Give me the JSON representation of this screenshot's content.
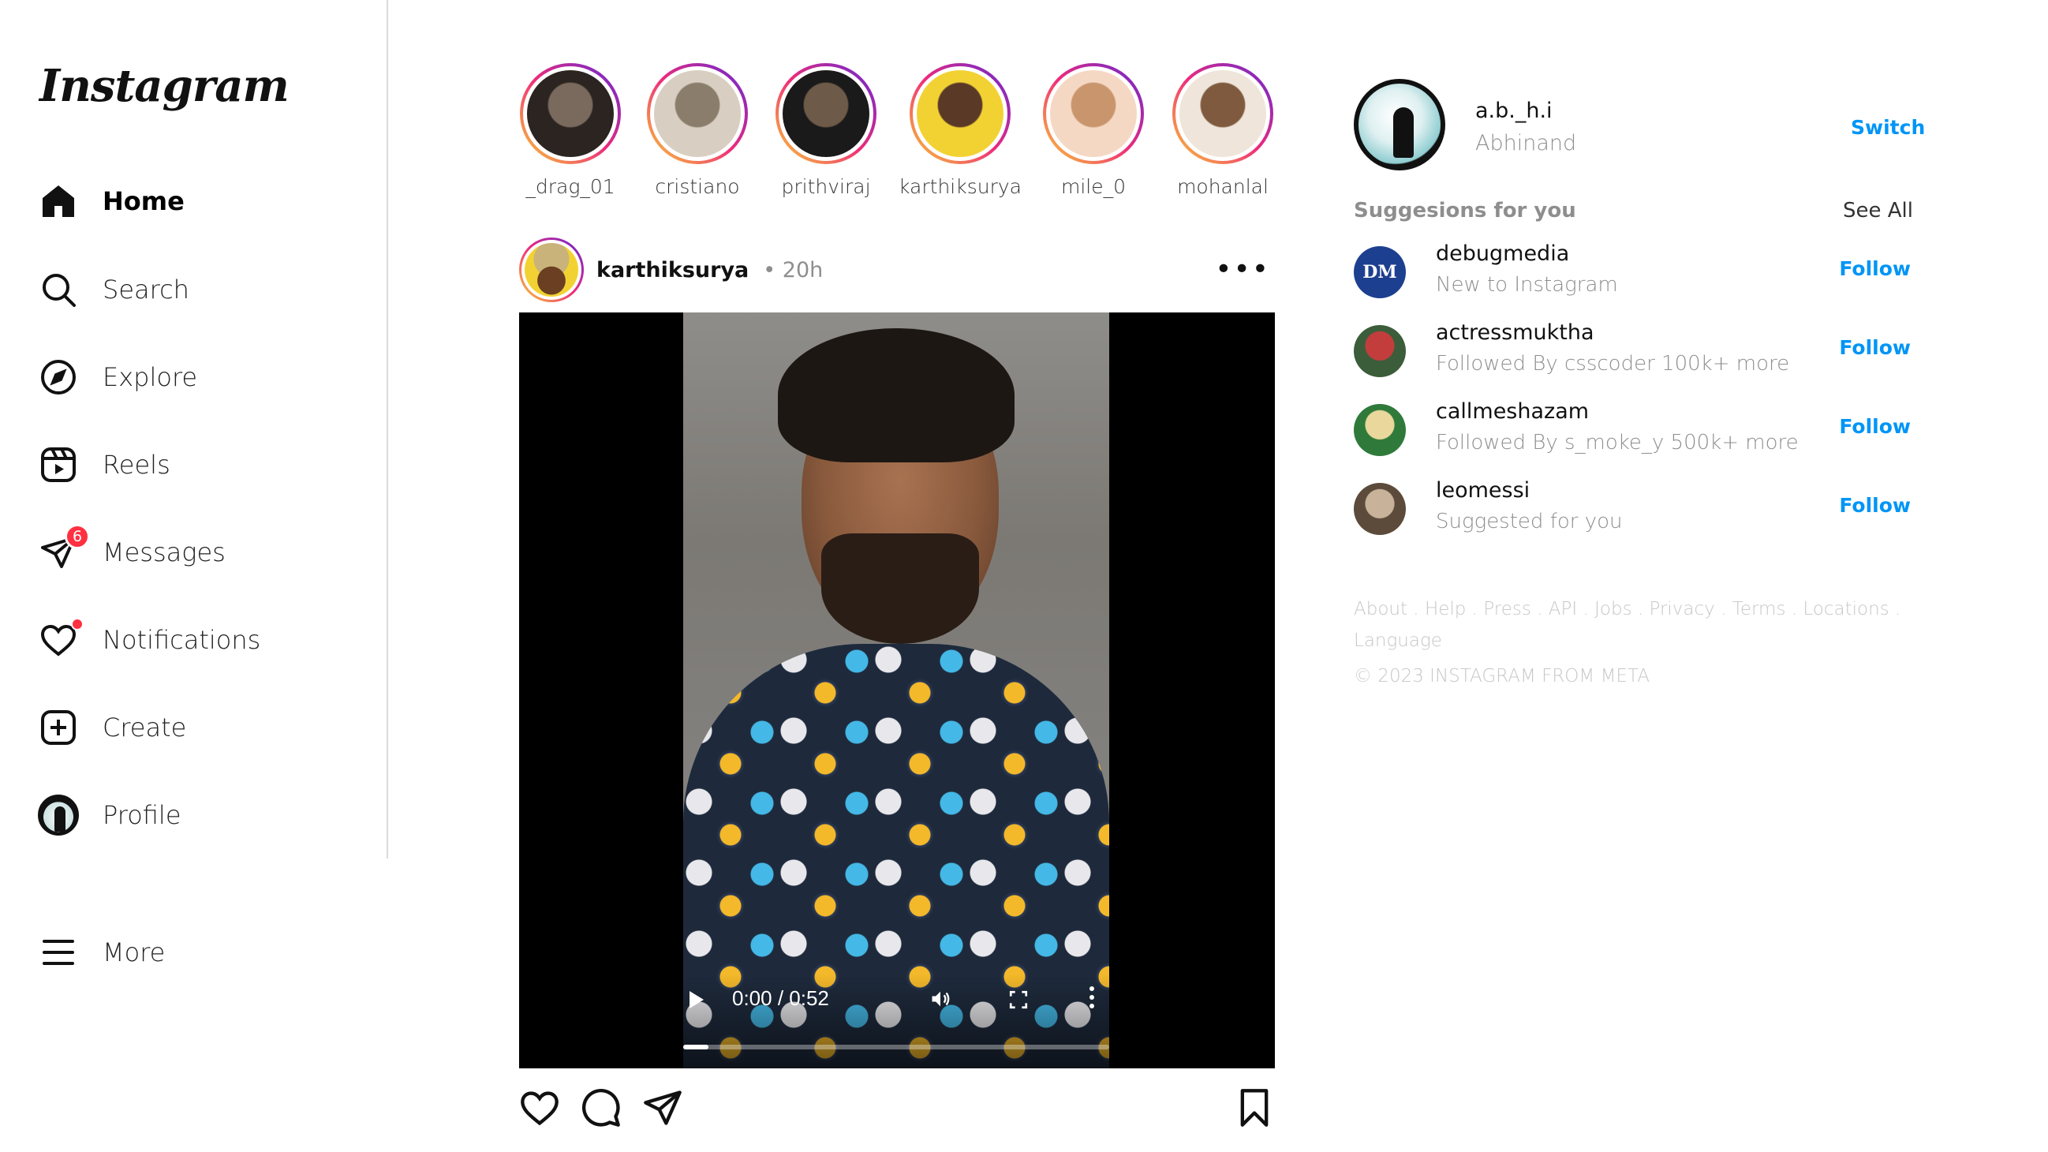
{
  "logo": "Instagram",
  "nav": [
    {
      "label": "Home"
    },
    {
      "label": "Search"
    },
    {
      "label": "Explore"
    },
    {
      "label": "Reels"
    },
    {
      "label": "Messages",
      "badge": "6"
    },
    {
      "label": "Notifications"
    },
    {
      "label": "Create"
    },
    {
      "label": "Profile"
    }
  ],
  "more_label": "More",
  "stories": [
    {
      "name": "_drag_01",
      "colors": [
        "#2b2420",
        "#7a6a5e"
      ]
    },
    {
      "name": "cristiano",
      "colors": [
        "#d8cfc2",
        "#8b7d6b"
      ]
    },
    {
      "name": "prithviraj",
      "colors": [
        "#1a1a1a",
        "#6e5a48"
      ]
    },
    {
      "name": "karthiksurya",
      "colors": [
        "#f2d233",
        "#5a3a26"
      ]
    },
    {
      "name": "mile_0",
      "colors": [
        "#f5d8c4",
        "#c9956d"
      ]
    },
    {
      "name": "mohanlal",
      "colors": [
        "#efe5da",
        "#7f5a3f"
      ]
    }
  ],
  "post": {
    "username": "karthiksurya",
    "time": "• 20h",
    "more": "•••",
    "video": {
      "time": "0:00 / 0:52",
      "progress": 0.06
    }
  },
  "me": {
    "username": "a.b._h.i",
    "name": "Abhinand",
    "switch_label": "Switch"
  },
  "suggestions_title": "Suggesions for you",
  "see_all": "See All",
  "suggestions": [
    {
      "username": "debugmedia",
      "subtitle": "New to Instagram",
      "follow": "Follow",
      "colors": [
        "#1d3f8f",
        "#1d3f8f"
      ],
      "mono": "DM"
    },
    {
      "username": "actressmuktha",
      "subtitle": "Followed By csscoder 100k+ more",
      "follow": "Follow",
      "colors": [
        "#c33d3d",
        "#3b5d3a"
      ],
      "mono": ""
    },
    {
      "username": "callmeshazam",
      "subtitle": "Followed By s_moke_y 500k+ more",
      "follow": "Follow",
      "colors": [
        "#e9d79b",
        "#2f7a3b"
      ],
      "mono": ""
    },
    {
      "username": "leomessi",
      "subtitle": "Suggested for you",
      "follow": "Follow",
      "colors": [
        "#c8b29a",
        "#5c4a3b"
      ],
      "mono": ""
    }
  ],
  "footer": {
    "links": [
      "About .",
      "Help .",
      "Press .",
      "API .",
      "Jobs .",
      "Privacy .",
      "Terms .",
      "Locations .",
      "Language"
    ],
    "copyright": "© 2023 INSTAGRAM FROM META"
  }
}
